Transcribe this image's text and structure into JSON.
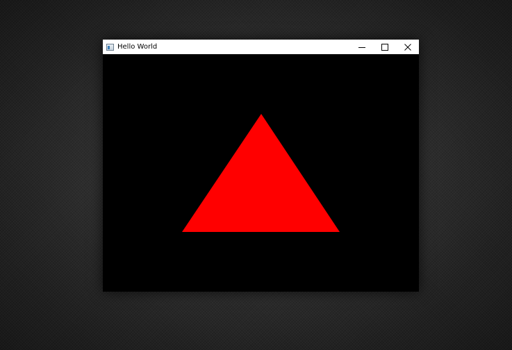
{
  "window": {
    "title": "Hello World",
    "icon": "app-window-icon",
    "controls": {
      "minimize_icon": "minimize-icon",
      "maximize_icon": "maximize-icon",
      "close_icon": "close-icon"
    }
  },
  "scene": {
    "background_color": "#000000",
    "shape": "triangle",
    "fill_color": "#ff0000"
  },
  "colors": {
    "desktop": "#2c2c2c",
    "titlebar": "#ffffff"
  }
}
